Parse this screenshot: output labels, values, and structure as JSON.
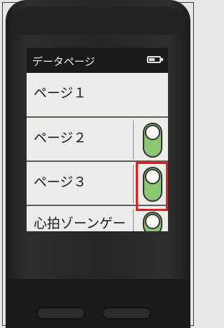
{
  "header": {
    "title": "データページ"
  },
  "rows": [
    {
      "label": "ページ１",
      "has_toggle": false
    },
    {
      "label": "ページ２",
      "has_toggle": true,
      "on": true
    },
    {
      "label": "ページ３",
      "has_toggle": true,
      "on": true
    },
    {
      "label": "心拍ゾーンゲー",
      "has_toggle": true,
      "on": true
    }
  ],
  "colors": {
    "toggle_on": "#8cc571",
    "highlight": "#e02020",
    "header_bg": "#1a1a1a"
  }
}
